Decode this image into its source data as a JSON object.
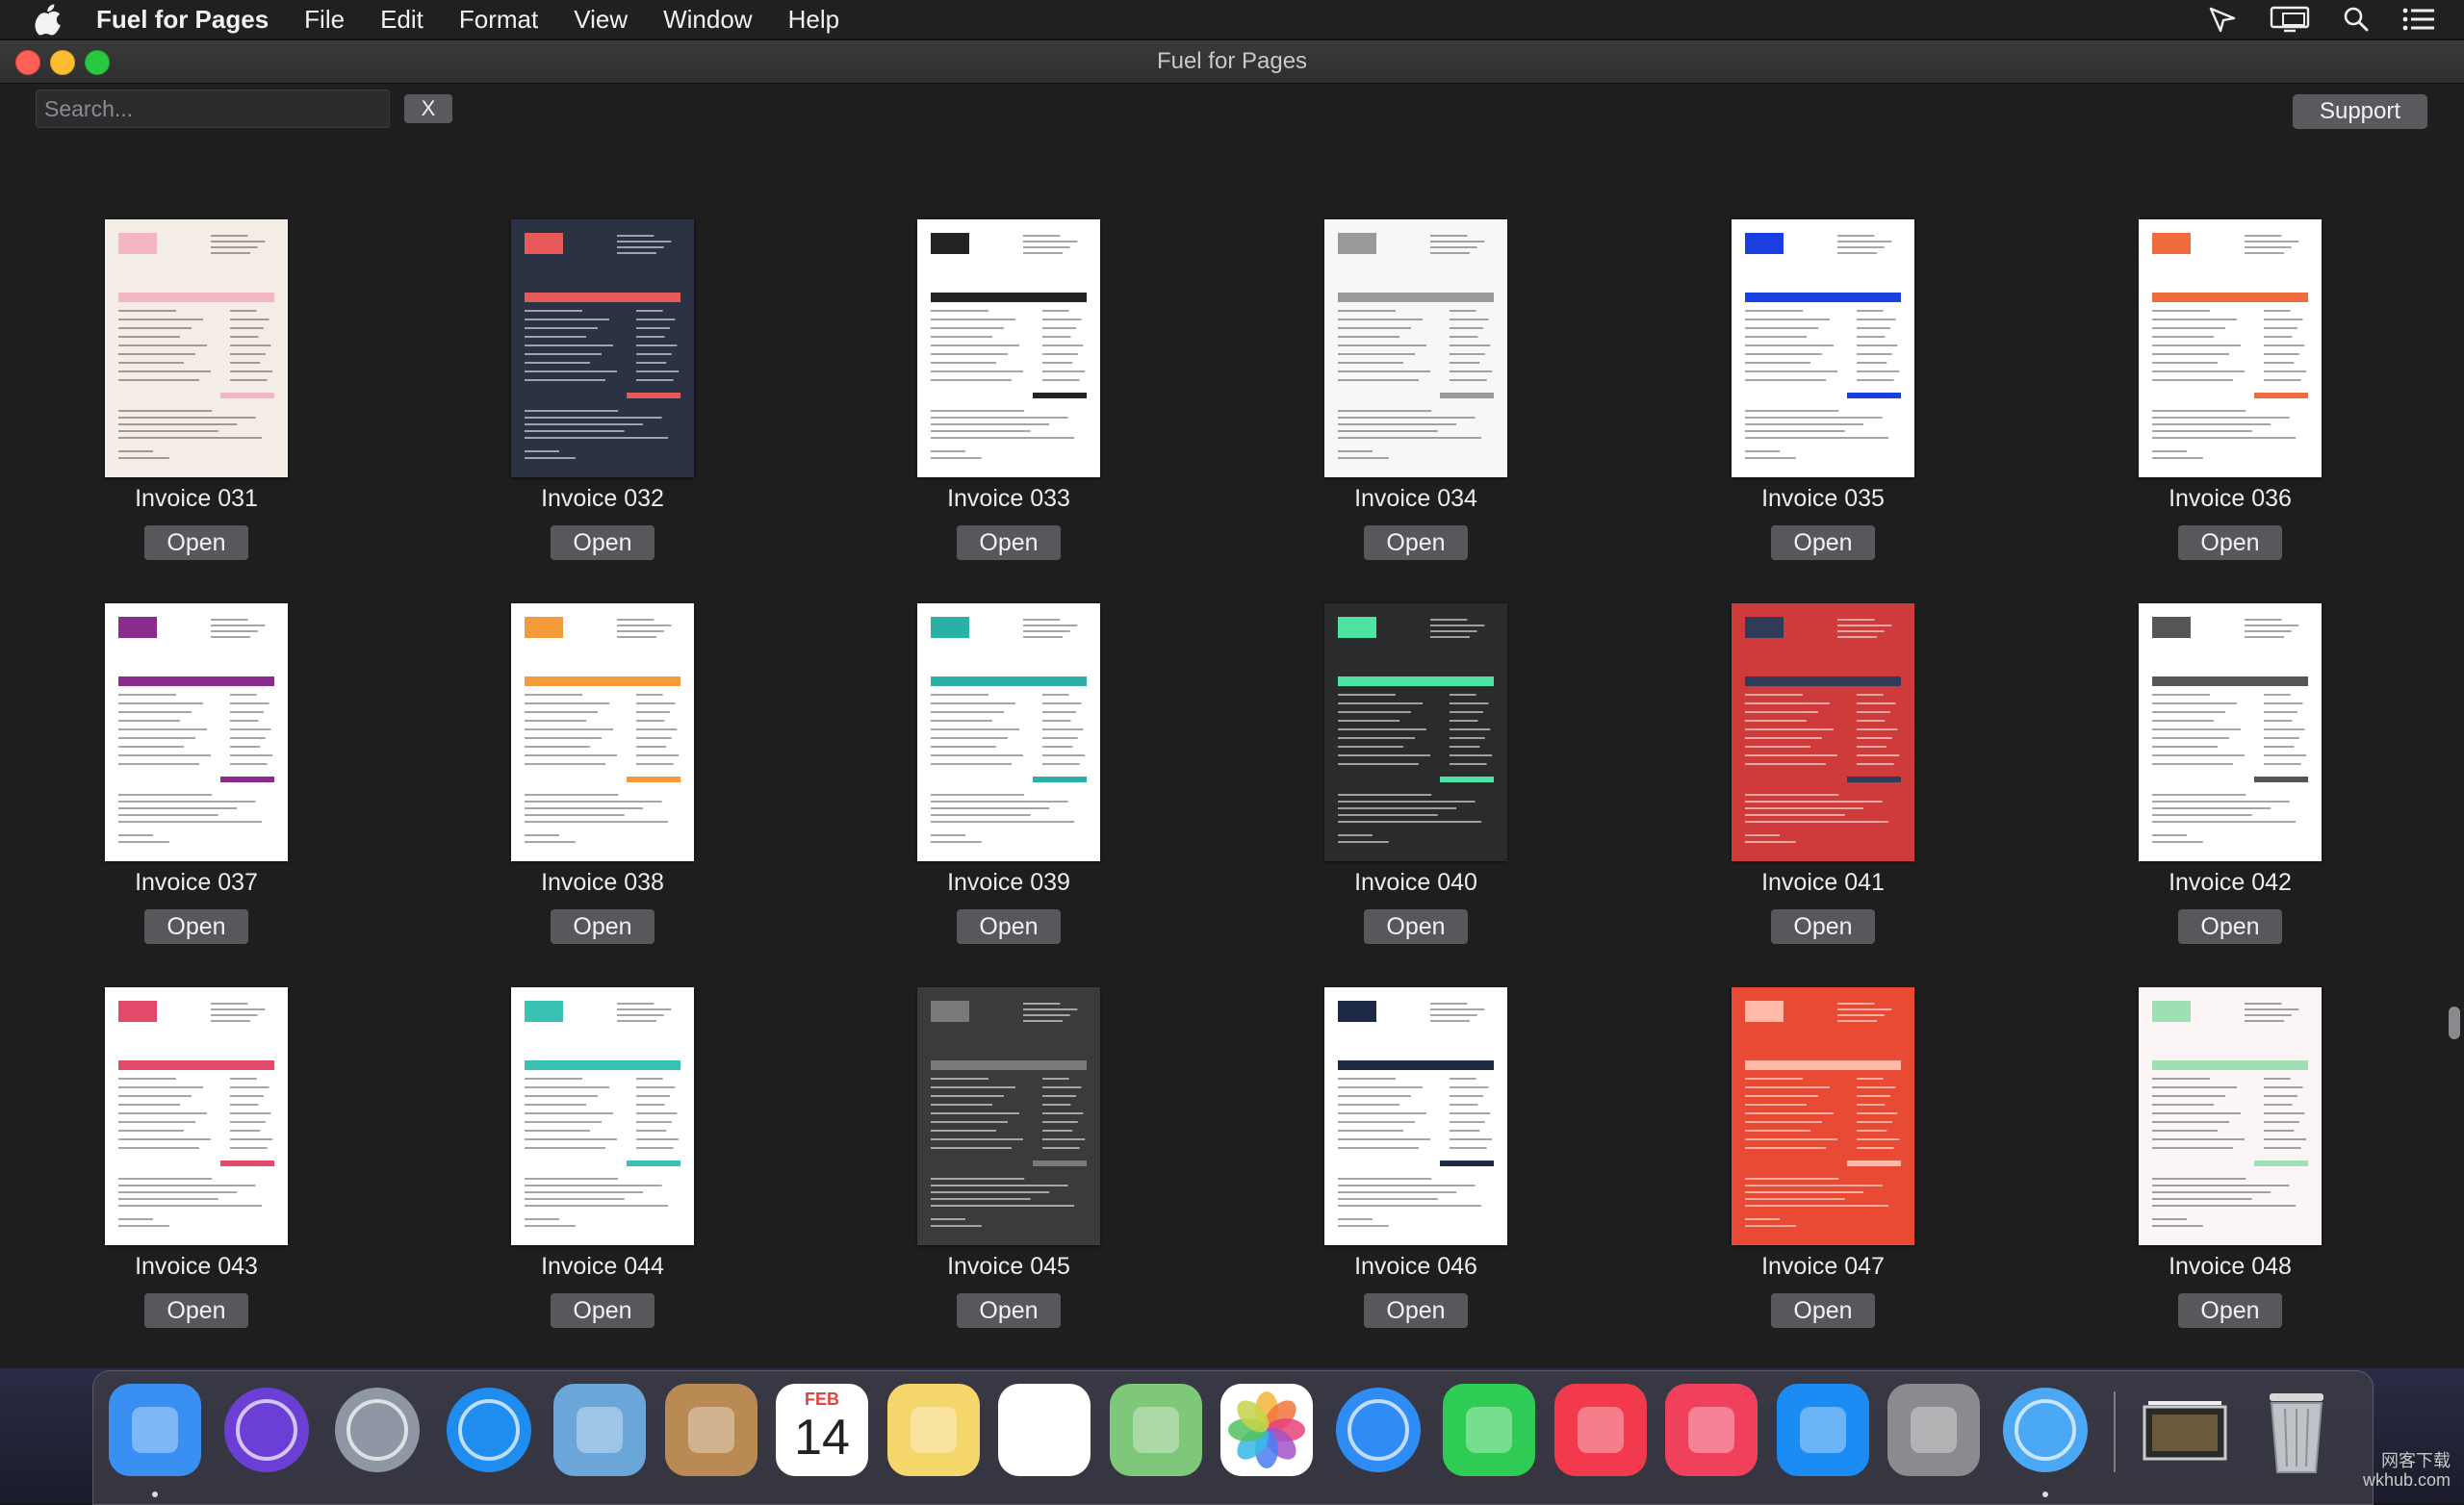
{
  "menubar": {
    "app_name": "Fuel for Pages",
    "items": [
      "File",
      "Edit",
      "Format",
      "View",
      "Window",
      "Help"
    ],
    "status_icons": [
      "location-arrow-icon",
      "airplay-display-icon",
      "spotlight-search-icon",
      "notification-center-icon"
    ]
  },
  "window": {
    "title": "Fuel for Pages",
    "search_placeholder": "Search...",
    "clear_label": "X",
    "support_label": "Support"
  },
  "grid": {
    "open_label": "Open",
    "items": [
      {
        "name": "Invoice 031",
        "accent": "#f2b7c3",
        "paper": "#f3ede6"
      },
      {
        "name": "Invoice 032",
        "accent": "#e8595a",
        "paper": "#2b3244"
      },
      {
        "name": "Invoice 033",
        "accent": "#222222",
        "paper": "#ffffff"
      },
      {
        "name": "Invoice 034",
        "accent": "#9a9a9a",
        "paper": "#f7f7f7"
      },
      {
        "name": "Invoice 035",
        "accent": "#1a3fe0",
        "paper": "#ffffff"
      },
      {
        "name": "Invoice 036",
        "accent": "#ef6a3c",
        "paper": "#ffffff"
      },
      {
        "name": "Invoice 037",
        "accent": "#8a2d8f",
        "paper": "#ffffff"
      },
      {
        "name": "Invoice 038",
        "accent": "#f49a3a",
        "paper": "#ffffff"
      },
      {
        "name": "Invoice 039",
        "accent": "#2ab0a4",
        "paper": "#ffffff"
      },
      {
        "name": "Invoice 040",
        "accent": "#4de3a2",
        "paper": "#2a2b2d"
      },
      {
        "name": "Invoice 041",
        "accent": "#2f3b57",
        "paper": "#cf3b3b"
      },
      {
        "name": "Invoice 042",
        "accent": "#555555",
        "paper": "#ffffff"
      },
      {
        "name": "Invoice 043",
        "accent": "#e24a6a",
        "paper": "#ffffff"
      },
      {
        "name": "Invoice 044",
        "accent": "#39c2b3",
        "paper": "#ffffff"
      },
      {
        "name": "Invoice 045",
        "accent": "#7a7a7a",
        "paper": "#3b3b3d"
      },
      {
        "name": "Invoice 046",
        "accent": "#1e2a44",
        "paper": "#ffffff"
      },
      {
        "name": "Invoice 047",
        "accent": "#ffb9a8",
        "paper": "#e94a33"
      },
      {
        "name": "Invoice 048",
        "accent": "#9ee0b4",
        "paper": "#fbf5f5"
      }
    ]
  },
  "dock": {
    "apps": [
      {
        "name": "finder-icon",
        "color": "#3a8ff2"
      },
      {
        "name": "siri-icon",
        "color": "#6b3fd6"
      },
      {
        "name": "launchpad-icon",
        "color": "#8f97a4"
      },
      {
        "name": "safari-icon",
        "color": "#1f8cf0"
      },
      {
        "name": "mail-icon",
        "color": "#6aa6d8"
      },
      {
        "name": "contacts-icon",
        "color": "#b98a54"
      },
      {
        "name": "calendar-icon",
        "color": "#ffffff"
      },
      {
        "name": "notes-icon",
        "color": "#f5d66a"
      },
      {
        "name": "reminders-icon",
        "color": "#ffffff"
      },
      {
        "name": "maps-icon",
        "color": "#7fc779"
      },
      {
        "name": "photos-icon",
        "color": "#ffffff"
      },
      {
        "name": "messages-icon",
        "color": "#2f8cf5"
      },
      {
        "name": "facetime-icon",
        "color": "#2ecc55"
      },
      {
        "name": "news-icon",
        "color": "#f23a4c"
      },
      {
        "name": "music-icon",
        "color": "#f1405c"
      },
      {
        "name": "app-store-icon",
        "color": "#1b8cf3"
      },
      {
        "name": "system-preferences-icon",
        "color": "#8b8b8f"
      },
      {
        "name": "fuel-app-icon",
        "color": "#4aa8f5"
      },
      {
        "name": "downloads-stack-icon",
        "color": "#d9d9d9"
      },
      {
        "name": "trash-icon",
        "color": "#cfcfcf"
      }
    ],
    "calendar_month": "FEB",
    "calendar_day": "14"
  },
  "watermark": {
    "line1": "网客下载",
    "line2": "wkhub.com"
  }
}
